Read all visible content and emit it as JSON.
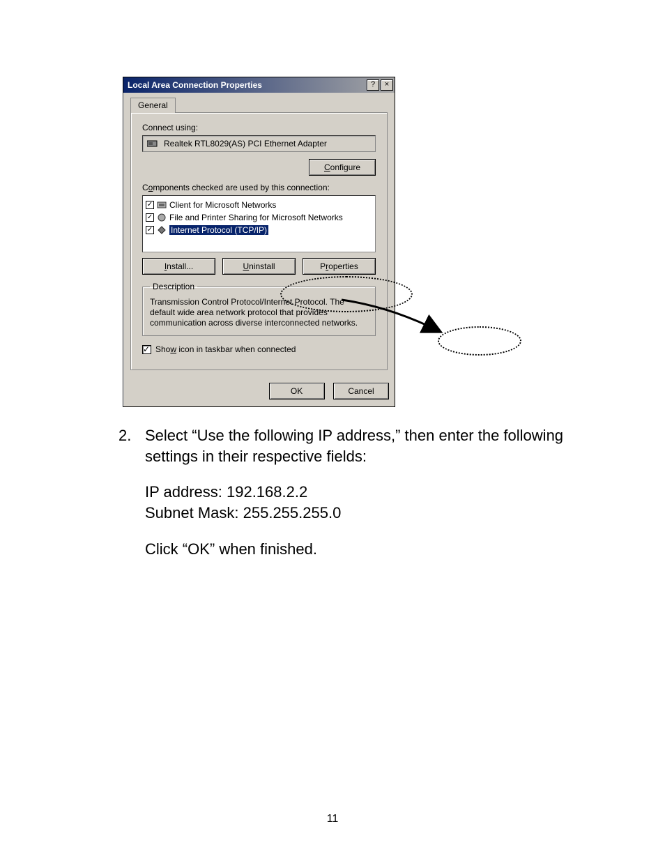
{
  "dialog": {
    "title": "Local Area Connection Properties",
    "help_btn": "?",
    "close_btn": "×",
    "tab": "General",
    "connect_using_label": "Connect using:",
    "adapter": "Realtek RTL8029(AS) PCI Ethernet Adapter",
    "configure_btn": "Configure",
    "components_label": "Components checked are used by this connection:",
    "items": [
      "Client for Microsoft Networks",
      "File and Printer Sharing for Microsoft Networks",
      "Internet Protocol (TCP/IP)"
    ],
    "install_btn": "Install...",
    "uninstall_btn": "Uninstall",
    "properties_btn": "Properties",
    "description_legend": "Description",
    "description_text": "Transmission Control Protocol/Internet Protocol. The default wide area network protocol that provides communication across diverse interconnected networks.",
    "show_icon": "Show icon in taskbar when connected",
    "ok": "OK",
    "cancel": "Cancel"
  },
  "doc": {
    "step_num": "2.",
    "step_text": "Select “Use the following IP address,” then enter the following settings in their respective fields:",
    "ip_line": "IP address: 192.168.2.2",
    "subnet_line": "Subnet Mask: 255.255.255.0",
    "ok_line": "Click “OK” when finished.",
    "page_number": "11"
  }
}
